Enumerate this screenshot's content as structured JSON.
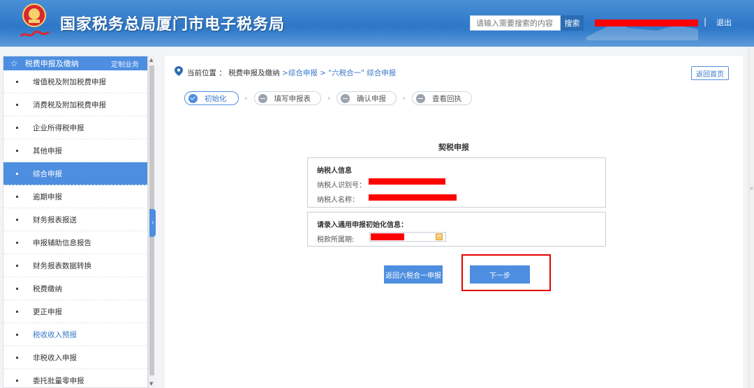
{
  "header": {
    "title": "国家税务总局厦门市电子税务局",
    "search_placeholder": "请输入需要搜索的内容",
    "search_button": "搜索",
    "separator": "|",
    "logout": "退出",
    "colors": {
      "bar": "#2f78c8",
      "redaction": "#ff0000"
    }
  },
  "sidebar": {
    "header_label": "税费申报及缴纳",
    "custom_label": "定制业务",
    "items": [
      {
        "label": "增值税及附加税费申报",
        "state": "normal"
      },
      {
        "label": "消费税及附加税费申报",
        "state": "normal"
      },
      {
        "label": "企业所得税申报",
        "state": "normal"
      },
      {
        "label": "其他申报",
        "state": "normal"
      },
      {
        "label": "综合申报",
        "state": "active"
      },
      {
        "label": "逾期申报",
        "state": "normal"
      },
      {
        "label": "财务报表报送",
        "state": "normal"
      },
      {
        "label": "申报辅助信息报告",
        "state": "normal"
      },
      {
        "label": "财务报表数据转换",
        "state": "normal"
      },
      {
        "label": "税费缴纳",
        "state": "normal"
      },
      {
        "label": "更正申报",
        "state": "normal"
      },
      {
        "label": "税收收入预报",
        "state": "link"
      },
      {
        "label": "非税收入申报",
        "state": "normal"
      },
      {
        "label": "委托批量零申报",
        "state": "normal"
      }
    ]
  },
  "breadcrumb": {
    "prefix": "当前位置 ：",
    "current": "税费申报及缴纳",
    "trail": ">综合申报 > \"六税合一\" 综合申报"
  },
  "return_home": "返回首页",
  "steps": [
    {
      "label": "初始化",
      "active": true
    },
    {
      "label": "填写申报表",
      "active": false
    },
    {
      "label": "确认申报",
      "active": false
    },
    {
      "label": "查看回执",
      "active": false
    }
  ],
  "form": {
    "title": "契税申报",
    "taxpayer_section": "纳税人信息",
    "taxpayer_id_label": "纳税人识别号：",
    "taxpayer_name_label": "纳税人名称：",
    "init_section": "请录入通用申报初始化信息：",
    "period_label": "税款所属期:"
  },
  "buttons": {
    "back": "返回六税合一申报",
    "next": "下一步"
  },
  "colors": {
    "accent": "#4d8ee0",
    "highlight_border": "#e60000"
  }
}
